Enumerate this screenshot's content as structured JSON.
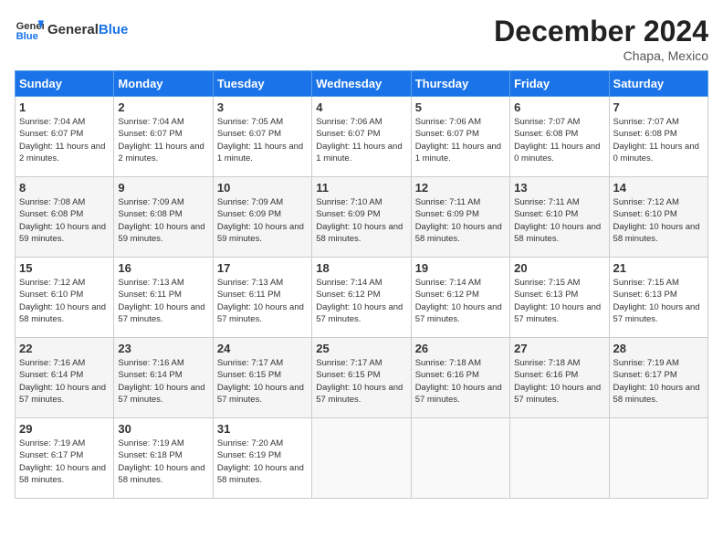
{
  "header": {
    "logo_general": "General",
    "logo_blue": "Blue",
    "month": "December 2024",
    "location": "Chapa, Mexico"
  },
  "days_of_week": [
    "Sunday",
    "Monday",
    "Tuesday",
    "Wednesday",
    "Thursday",
    "Friday",
    "Saturday"
  ],
  "weeks": [
    [
      {
        "num": "1",
        "sunrise": "7:04 AM",
        "sunset": "6:07 PM",
        "daylight": "11 hours and 2 minutes."
      },
      {
        "num": "2",
        "sunrise": "7:04 AM",
        "sunset": "6:07 PM",
        "daylight": "11 hours and 2 minutes."
      },
      {
        "num": "3",
        "sunrise": "7:05 AM",
        "sunset": "6:07 PM",
        "daylight": "11 hours and 1 minute."
      },
      {
        "num": "4",
        "sunrise": "7:06 AM",
        "sunset": "6:07 PM",
        "daylight": "11 hours and 1 minute."
      },
      {
        "num": "5",
        "sunrise": "7:06 AM",
        "sunset": "6:07 PM",
        "daylight": "11 hours and 1 minute."
      },
      {
        "num": "6",
        "sunrise": "7:07 AM",
        "sunset": "6:08 PM",
        "daylight": "11 hours and 0 minutes."
      },
      {
        "num": "7",
        "sunrise": "7:07 AM",
        "sunset": "6:08 PM",
        "daylight": "11 hours and 0 minutes."
      }
    ],
    [
      {
        "num": "8",
        "sunrise": "7:08 AM",
        "sunset": "6:08 PM",
        "daylight": "10 hours and 59 minutes."
      },
      {
        "num": "9",
        "sunrise": "7:09 AM",
        "sunset": "6:08 PM",
        "daylight": "10 hours and 59 minutes."
      },
      {
        "num": "10",
        "sunrise": "7:09 AM",
        "sunset": "6:09 PM",
        "daylight": "10 hours and 59 minutes."
      },
      {
        "num": "11",
        "sunrise": "7:10 AM",
        "sunset": "6:09 PM",
        "daylight": "10 hours and 58 minutes."
      },
      {
        "num": "12",
        "sunrise": "7:11 AM",
        "sunset": "6:09 PM",
        "daylight": "10 hours and 58 minutes."
      },
      {
        "num": "13",
        "sunrise": "7:11 AM",
        "sunset": "6:10 PM",
        "daylight": "10 hours and 58 minutes."
      },
      {
        "num": "14",
        "sunrise": "7:12 AM",
        "sunset": "6:10 PM",
        "daylight": "10 hours and 58 minutes."
      }
    ],
    [
      {
        "num": "15",
        "sunrise": "7:12 AM",
        "sunset": "6:10 PM",
        "daylight": "10 hours and 58 minutes."
      },
      {
        "num": "16",
        "sunrise": "7:13 AM",
        "sunset": "6:11 PM",
        "daylight": "10 hours and 57 minutes."
      },
      {
        "num": "17",
        "sunrise": "7:13 AM",
        "sunset": "6:11 PM",
        "daylight": "10 hours and 57 minutes."
      },
      {
        "num": "18",
        "sunrise": "7:14 AM",
        "sunset": "6:12 PM",
        "daylight": "10 hours and 57 minutes."
      },
      {
        "num": "19",
        "sunrise": "7:14 AM",
        "sunset": "6:12 PM",
        "daylight": "10 hours and 57 minutes."
      },
      {
        "num": "20",
        "sunrise": "7:15 AM",
        "sunset": "6:13 PM",
        "daylight": "10 hours and 57 minutes."
      },
      {
        "num": "21",
        "sunrise": "7:15 AM",
        "sunset": "6:13 PM",
        "daylight": "10 hours and 57 minutes."
      }
    ],
    [
      {
        "num": "22",
        "sunrise": "7:16 AM",
        "sunset": "6:14 PM",
        "daylight": "10 hours and 57 minutes."
      },
      {
        "num": "23",
        "sunrise": "7:16 AM",
        "sunset": "6:14 PM",
        "daylight": "10 hours and 57 minutes."
      },
      {
        "num": "24",
        "sunrise": "7:17 AM",
        "sunset": "6:15 PM",
        "daylight": "10 hours and 57 minutes."
      },
      {
        "num": "25",
        "sunrise": "7:17 AM",
        "sunset": "6:15 PM",
        "daylight": "10 hours and 57 minutes."
      },
      {
        "num": "26",
        "sunrise": "7:18 AM",
        "sunset": "6:16 PM",
        "daylight": "10 hours and 57 minutes."
      },
      {
        "num": "27",
        "sunrise": "7:18 AM",
        "sunset": "6:16 PM",
        "daylight": "10 hours and 57 minutes."
      },
      {
        "num": "28",
        "sunrise": "7:19 AM",
        "sunset": "6:17 PM",
        "daylight": "10 hours and 58 minutes."
      }
    ],
    [
      {
        "num": "29",
        "sunrise": "7:19 AM",
        "sunset": "6:17 PM",
        "daylight": "10 hours and 58 minutes."
      },
      {
        "num": "30",
        "sunrise": "7:19 AM",
        "sunset": "6:18 PM",
        "daylight": "10 hours and 58 minutes."
      },
      {
        "num": "31",
        "sunrise": "7:20 AM",
        "sunset": "6:19 PM",
        "daylight": "10 hours and 58 minutes."
      },
      null,
      null,
      null,
      null
    ]
  ]
}
